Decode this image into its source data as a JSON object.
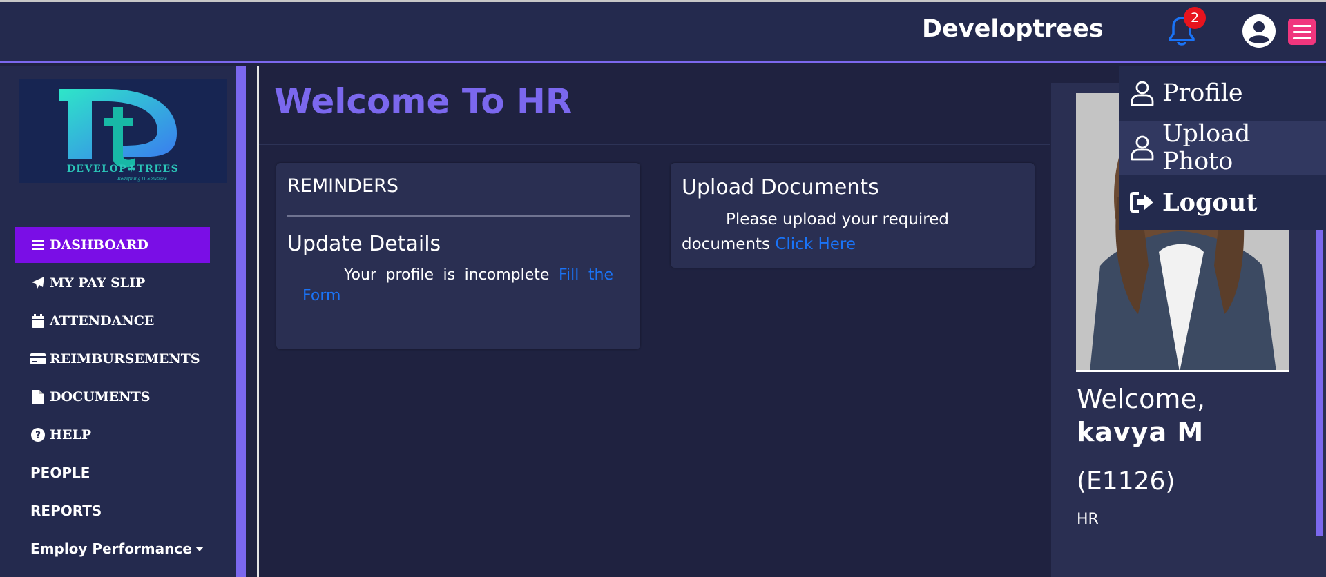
{
  "header": {
    "brand": "Developtrees",
    "notification_count": "2",
    "icons": [
      "bell-icon",
      "user-circle-icon",
      "hamburger-icon"
    ]
  },
  "sidebar": {
    "logo_text": "DEVELOP TREES",
    "logo_tagline": "Redefining IT Solutions",
    "items": [
      {
        "label": "DASHBOARD",
        "icon": "bars-icon"
      },
      {
        "label": "MY PAY SLIP",
        "icon": "paper-plane-icon"
      },
      {
        "label": "ATTENDANCE",
        "icon": "calendar-icon"
      },
      {
        "label": "REIMBURSEMENTS",
        "icon": "credit-card-icon"
      },
      {
        "label": "DOCUMENTS",
        "icon": "file-icon"
      },
      {
        "label": "HELP",
        "icon": "question-circle-icon"
      },
      {
        "label": "PEOPLE"
      },
      {
        "label": "REPORTS"
      },
      {
        "label": "Employ Performance",
        "icon": "caret-down-icon"
      }
    ]
  },
  "main": {
    "title": "Welcome To HR",
    "reminders": {
      "title": "REMINDERS",
      "subtitle": "Update Details",
      "text": "Your profile is incomplete ",
      "link": "Fill the Form"
    },
    "upload": {
      "title": "Upload Documents",
      "text": "Please upload your required documents ",
      "link": "Click Here"
    }
  },
  "profile": {
    "welcome": "Welcome,",
    "name": "kavya  M",
    "employee_id": "(E1126)",
    "role": "HR"
  },
  "dropdown": {
    "items": [
      {
        "label": "Profile",
        "icon": "user-icon"
      },
      {
        "label": "Upload Photo",
        "icon": "user-icon"
      },
      {
        "label": "Logout",
        "icon": "sign-out-icon"
      }
    ]
  },
  "colors": {
    "accent": "#7b68ee",
    "active_nav": "#7a0ee6",
    "link": "#1a73f6",
    "menu_button": "#f0367e",
    "badge": "#e8141e"
  }
}
